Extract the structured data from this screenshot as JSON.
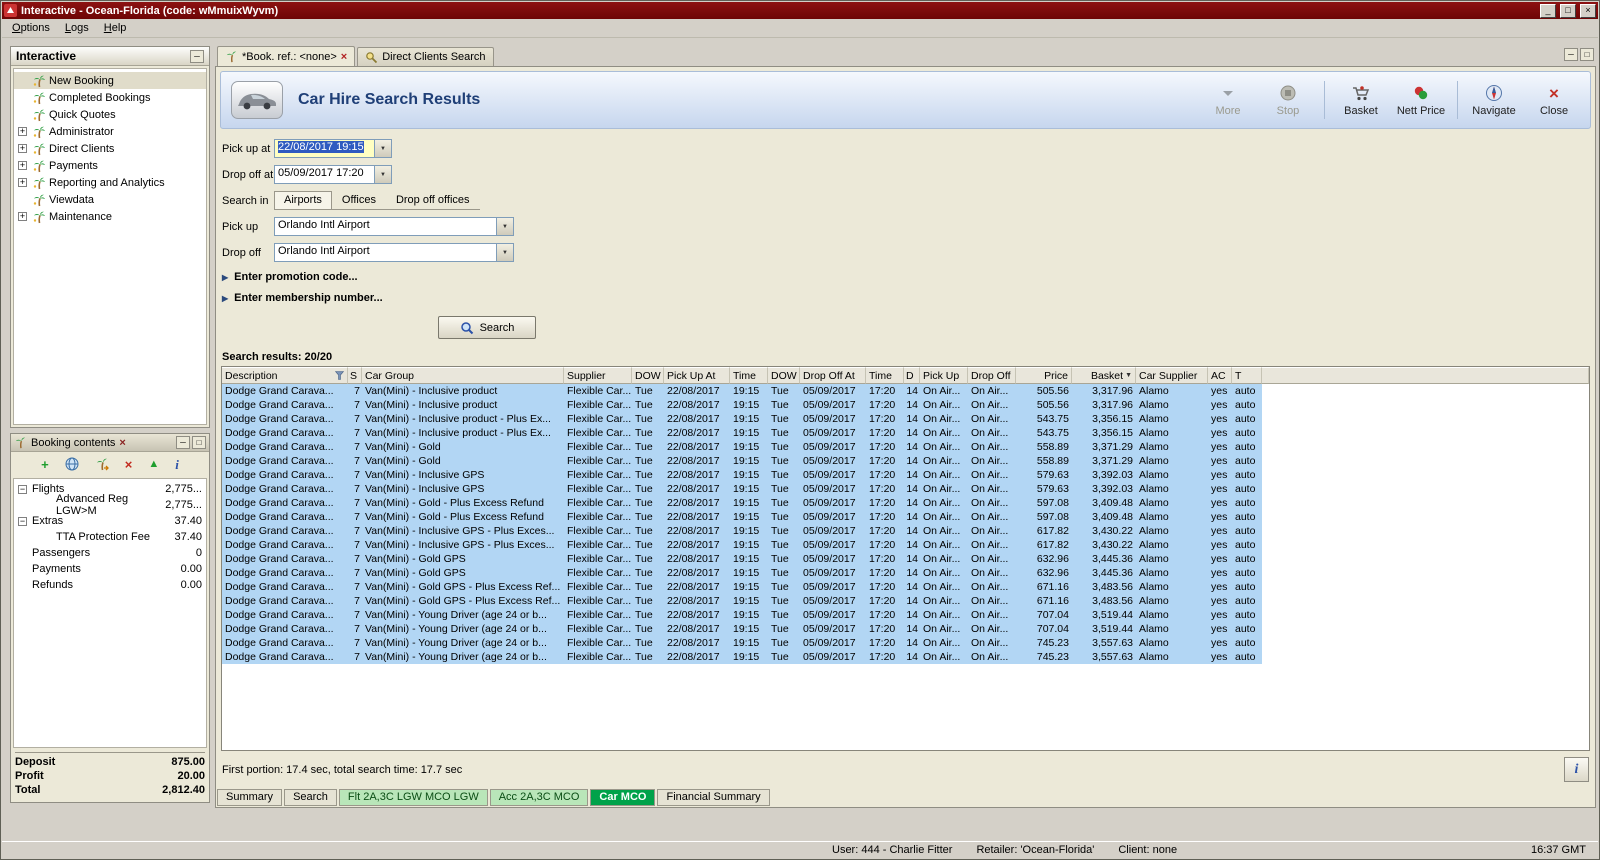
{
  "window": {
    "title": "Interactive - Ocean-Florida (code: wMmuixWyvm)",
    "menu": [
      "Options",
      "Logs",
      "Help"
    ],
    "controls": {
      "minimize": "_",
      "maximize": "□",
      "close": "×"
    }
  },
  "icons": {
    "add": "+",
    "delete": "×",
    "move_up": "▲",
    "info": "i",
    "dropdown_arrow": "▼",
    "expand_triangle": "▶",
    "sort_desc": "▼",
    "collapse": "─",
    "panel_minimize": "─",
    "panel_maximize": "□",
    "tab_close": "×"
  },
  "sidebar": {
    "title": "Interactive",
    "items": [
      {
        "label": "New Booking",
        "icon": "new-booking-icon",
        "_class": "selected"
      },
      {
        "label": "Completed Bookings",
        "icon": "completed-bookings-icon"
      },
      {
        "label": "Quick Quotes",
        "icon": "quick-quotes-icon"
      },
      {
        "label": "Administrator",
        "icon": "administrator-icon",
        "expandable": "+"
      },
      {
        "label": "Direct Clients",
        "icon": "direct-clients-icon",
        "expandable": "+"
      },
      {
        "label": "Payments",
        "icon": "payments-icon",
        "expandable": "+"
      },
      {
        "label": "Reporting and Analytics",
        "icon": "reporting-icon",
        "expandable": "+"
      },
      {
        "label": "Viewdata",
        "icon": "viewdata-icon"
      },
      {
        "label": "Maintenance",
        "icon": "maintenance-icon",
        "expandable": "+"
      }
    ]
  },
  "booking": {
    "title": "Booking contents",
    "tree": [
      {
        "label": "Flights",
        "value": "2,775...",
        "expander": "−"
      },
      {
        "label": "Advanced Reg LGW>M",
        "value": "2,775...",
        "_class": "child"
      },
      {
        "label": "Extras",
        "value": "37.40",
        "expander": "−"
      },
      {
        "label": "TTA Protection Fee",
        "value": "37.40",
        "_class": "child"
      },
      {
        "label": "Passengers",
        "value": "0"
      },
      {
        "label": "Payments",
        "value": "0.00"
      },
      {
        "label": "Refunds",
        "value": "0.00"
      }
    ],
    "totals": [
      {
        "label": "Deposit",
        "value": "875.00"
      },
      {
        "label": "Profit",
        "value": "20.00"
      },
      {
        "label": "Total",
        "value": "2,812.40"
      }
    ]
  },
  "doc": {
    "tabs": [
      {
        "label": "*Book. ref.: <none>"
      },
      {
        "label": "Direct Clients Search"
      }
    ],
    "header": {
      "title": "Car Hire Search Results",
      "buttons": [
        {
          "label": "More",
          "disabled": true
        },
        {
          "label": "Stop",
          "disabled": true
        },
        {
          "label": "Basket"
        },
        {
          "label": "Nett Price"
        },
        {
          "label": "Navigate"
        },
        {
          "label": "Close"
        }
      ]
    },
    "form": {
      "pickup_at": {
        "label": "Pick up at",
        "value": "22/08/2017 19:15"
      },
      "dropoff_at": {
        "label": "Drop off at",
        "value": "05/09/2017 17:20"
      },
      "search_in": {
        "label": "Search in",
        "tabs": [
          {
            "label": "Airports",
            "_class": "active"
          },
          {
            "label": "Offices"
          },
          {
            "label": "Drop off offices"
          }
        ]
      },
      "pickup": {
        "label": "Pick up",
        "value": "Orlando Intl Airport"
      },
      "dropoff": {
        "label": "Drop off",
        "value": "Orlando Intl Airport"
      },
      "promotion": "Enter promotion code...",
      "membership": "Enter membership number...",
      "search_button": "Search"
    },
    "results": {
      "summary": "Search results: 20/20",
      "columns": [
        "Description",
        "S",
        "Car Group",
        "Supplier",
        "DOW",
        "Pick Up At",
        "Time",
        "DOW",
        "Drop Off At",
        "Time",
        "D",
        "Pick Up",
        "Drop Off",
        "Price",
        "Basket",
        "Car Supplier",
        "AC",
        "T"
      ],
      "rows": [
        [
          "Dodge Grand Carava...",
          "7",
          "Van(Mini) - Inclusive product",
          "Flexible Car...",
          "Tue",
          "22/08/2017",
          "19:15",
          "Tue",
          "05/09/2017",
          "17:20",
          "14",
          "On Air...",
          "On Air...",
          "505.56",
          "3,317.96",
          "Alamo",
          "yes",
          "auto"
        ],
        [
          "Dodge Grand Carava...",
          "7",
          "Van(Mini) - Inclusive product",
          "Flexible Car...",
          "Tue",
          "22/08/2017",
          "19:15",
          "Tue",
          "05/09/2017",
          "17:20",
          "14",
          "On Air...",
          "On Air...",
          "505.56",
          "3,317.96",
          "Alamo",
          "yes",
          "auto"
        ],
        [
          "Dodge Grand Carava...",
          "7",
          "Van(Mini) - Inclusive product - Plus Ex...",
          "Flexible Car...",
          "Tue",
          "22/08/2017",
          "19:15",
          "Tue",
          "05/09/2017",
          "17:20",
          "14",
          "On Air...",
          "On Air...",
          "543.75",
          "3,356.15",
          "Alamo",
          "yes",
          "auto"
        ],
        [
          "Dodge Grand Carava...",
          "7",
          "Van(Mini) - Inclusive product - Plus Ex...",
          "Flexible Car...",
          "Tue",
          "22/08/2017",
          "19:15",
          "Tue",
          "05/09/2017",
          "17:20",
          "14",
          "On Air...",
          "On Air...",
          "543.75",
          "3,356.15",
          "Alamo",
          "yes",
          "auto"
        ],
        [
          "Dodge Grand Carava...",
          "7",
          "Van(Mini) - Gold",
          "Flexible Car...",
          "Tue",
          "22/08/2017",
          "19:15",
          "Tue",
          "05/09/2017",
          "17:20",
          "14",
          "On Air...",
          "On Air...",
          "558.89",
          "3,371.29",
          "Alamo",
          "yes",
          "auto"
        ],
        [
          "Dodge Grand Carava...",
          "7",
          "Van(Mini) - Gold",
          "Flexible Car...",
          "Tue",
          "22/08/2017",
          "19:15",
          "Tue",
          "05/09/2017",
          "17:20",
          "14",
          "On Air...",
          "On Air...",
          "558.89",
          "3,371.29",
          "Alamo",
          "yes",
          "auto"
        ],
        [
          "Dodge Grand Carava...",
          "7",
          "Van(Mini) - Inclusive GPS",
          "Flexible Car...",
          "Tue",
          "22/08/2017",
          "19:15",
          "Tue",
          "05/09/2017",
          "17:20",
          "14",
          "On Air...",
          "On Air...",
          "579.63",
          "3,392.03",
          "Alamo",
          "yes",
          "auto"
        ],
        [
          "Dodge Grand Carava...",
          "7",
          "Van(Mini) - Inclusive GPS",
          "Flexible Car...",
          "Tue",
          "22/08/2017",
          "19:15",
          "Tue",
          "05/09/2017",
          "17:20",
          "14",
          "On Air...",
          "On Air...",
          "579.63",
          "3,392.03",
          "Alamo",
          "yes",
          "auto"
        ],
        [
          "Dodge Grand Carava...",
          "7",
          "Van(Mini) - Gold - Plus Excess Refund",
          "Flexible Car...",
          "Tue",
          "22/08/2017",
          "19:15",
          "Tue",
          "05/09/2017",
          "17:20",
          "14",
          "On Air...",
          "On Air...",
          "597.08",
          "3,409.48",
          "Alamo",
          "yes",
          "auto"
        ],
        [
          "Dodge Grand Carava...",
          "7",
          "Van(Mini) - Gold - Plus Excess Refund",
          "Flexible Car...",
          "Tue",
          "22/08/2017",
          "19:15",
          "Tue",
          "05/09/2017",
          "17:20",
          "14",
          "On Air...",
          "On Air...",
          "597.08",
          "3,409.48",
          "Alamo",
          "yes",
          "auto"
        ],
        [
          "Dodge Grand Carava...",
          "7",
          "Van(Mini) - Inclusive GPS - Plus Exces...",
          "Flexible Car...",
          "Tue",
          "22/08/2017",
          "19:15",
          "Tue",
          "05/09/2017",
          "17:20",
          "14",
          "On Air...",
          "On Air...",
          "617.82",
          "3,430.22",
          "Alamo",
          "yes",
          "auto"
        ],
        [
          "Dodge Grand Carava...",
          "7",
          "Van(Mini) - Inclusive GPS - Plus Exces...",
          "Flexible Car...",
          "Tue",
          "22/08/2017",
          "19:15",
          "Tue",
          "05/09/2017",
          "17:20",
          "14",
          "On Air...",
          "On Air...",
          "617.82",
          "3,430.22",
          "Alamo",
          "yes",
          "auto"
        ],
        [
          "Dodge Grand Carava...",
          "7",
          "Van(Mini) - Gold GPS",
          "Flexible Car...",
          "Tue",
          "22/08/2017",
          "19:15",
          "Tue",
          "05/09/2017",
          "17:20",
          "14",
          "On Air...",
          "On Air...",
          "632.96",
          "3,445.36",
          "Alamo",
          "yes",
          "auto"
        ],
        [
          "Dodge Grand Carava...",
          "7",
          "Van(Mini) - Gold GPS",
          "Flexible Car...",
          "Tue",
          "22/08/2017",
          "19:15",
          "Tue",
          "05/09/2017",
          "17:20",
          "14",
          "On Air...",
          "On Air...",
          "632.96",
          "3,445.36",
          "Alamo",
          "yes",
          "auto"
        ],
        [
          "Dodge Grand Carava...",
          "7",
          "Van(Mini) - Gold GPS - Plus Excess Ref...",
          "Flexible Car...",
          "Tue",
          "22/08/2017",
          "19:15",
          "Tue",
          "05/09/2017",
          "17:20",
          "14",
          "On Air...",
          "On Air...",
          "671.16",
          "3,483.56",
          "Alamo",
          "yes",
          "auto"
        ],
        [
          "Dodge Grand Carava...",
          "7",
          "Van(Mini) - Gold GPS - Plus Excess Ref...",
          "Flexible Car...",
          "Tue",
          "22/08/2017",
          "19:15",
          "Tue",
          "05/09/2017",
          "17:20",
          "14",
          "On Air...",
          "On Air...",
          "671.16",
          "3,483.56",
          "Alamo",
          "yes",
          "auto"
        ],
        [
          "Dodge Grand Carava...",
          "7",
          "Van(Mini) - Young Driver (age 24 or b...",
          "Flexible Car...",
          "Tue",
          "22/08/2017",
          "19:15",
          "Tue",
          "05/09/2017",
          "17:20",
          "14",
          "On Air...",
          "On Air...",
          "707.04",
          "3,519.44",
          "Alamo",
          "yes",
          "auto"
        ],
        [
          "Dodge Grand Carava...",
          "7",
          "Van(Mini) - Young Driver (age 24 or b...",
          "Flexible Car...",
          "Tue",
          "22/08/2017",
          "19:15",
          "Tue",
          "05/09/2017",
          "17:20",
          "14",
          "On Air...",
          "On Air...",
          "707.04",
          "3,519.44",
          "Alamo",
          "yes",
          "auto"
        ],
        [
          "Dodge Grand Carava...",
          "7",
          "Van(Mini) - Young Driver (age 24 or b...",
          "Flexible Car...",
          "Tue",
          "22/08/2017",
          "19:15",
          "Tue",
          "05/09/2017",
          "17:20",
          "14",
          "On Air...",
          "On Air...",
          "745.23",
          "3,557.63",
          "Alamo",
          "yes",
          "auto"
        ],
        [
          "Dodge Grand Carava...",
          "7",
          "Van(Mini) - Young Driver (age 24 or b...",
          "Flexible Car...",
          "Tue",
          "22/08/2017",
          "19:15",
          "Tue",
          "05/09/2017",
          "17:20",
          "14",
          "On Air...",
          "On Air...",
          "745.23",
          "3,557.63",
          "Alamo",
          "yes",
          "auto"
        ]
      ]
    },
    "status_line": "First portion: 17.4 sec, total search time: 17.7 sec",
    "bottom_tabs": [
      {
        "label": "Summary"
      },
      {
        "label": "Search"
      },
      {
        "label": "Flt 2A,3C LGW MCO LGW",
        "_class": "green"
      },
      {
        "label": "Acc 2A,3C MCO",
        "_class": "green"
      },
      {
        "label": "Car MCO",
        "_class": "green-active"
      },
      {
        "label": "Financial Summary"
      }
    ]
  },
  "statusbar": {
    "user": "User: 444 - Charlie Fitter",
    "retailer": "Retailer: 'Ocean-Florida'",
    "client": "Client: none",
    "time": "16:37 GMT"
  }
}
